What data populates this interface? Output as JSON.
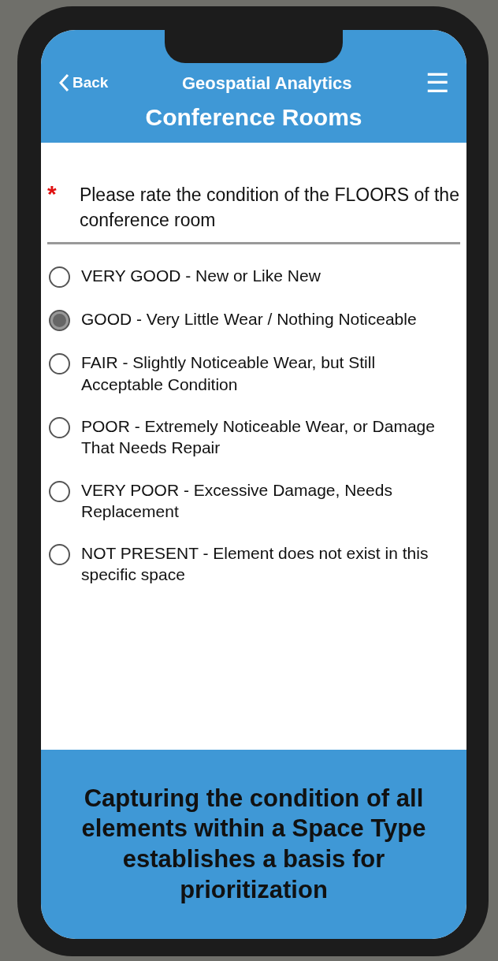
{
  "header": {
    "back": "Back",
    "app_title": "Geospatial Analytics",
    "menu": "☰",
    "page_title": "Conference Rooms"
  },
  "question": {
    "required_mark": "*",
    "text": "Please rate the condition of the FLOORS of the conference room"
  },
  "options": [
    {
      "label": "VERY GOOD - New or Like New",
      "selected": false
    },
    {
      "label": "GOOD - Very Little Wear / Nothing Noticeable",
      "selected": true
    },
    {
      "label": "FAIR - Slightly Noticeable Wear, but Still Acceptable Condition",
      "selected": false
    },
    {
      "label": "POOR - Extremely Noticeable Wear, or Damage That Needs Repair",
      "selected": false
    },
    {
      "label": "VERY POOR - Excessive Damage, Needs Replacement",
      "selected": false
    },
    {
      "label": "NOT PRESENT - Element does not exist in this specific space",
      "selected": false
    }
  ],
  "banner": {
    "text": "Capturing the condition of all elements within a Space Type establishes a basis for prioritization"
  }
}
